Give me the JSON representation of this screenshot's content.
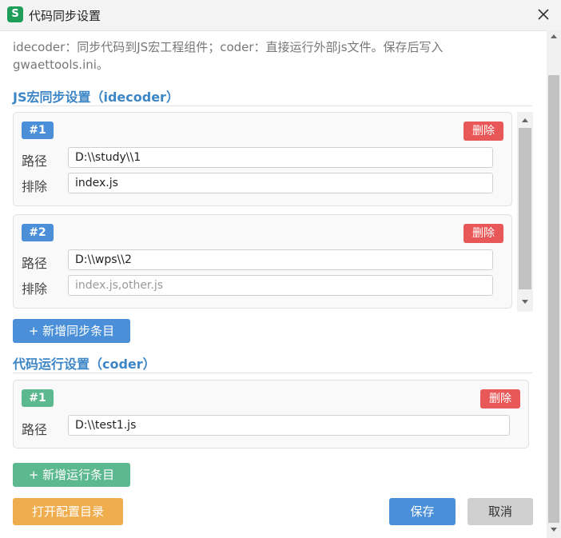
{
  "window": {
    "icon_letter": "S",
    "title": "代码同步设置",
    "close_glyph": "✕"
  },
  "description": "idecoder：同步代码到JS宏工程组件；coder：直接运行外部js文件。保存后写入gwaettools.ini。",
  "sync_section": {
    "title": "JS宏同步设置（idecoder）",
    "entries": [
      {
        "badge": "#1",
        "delete_label": "删除",
        "path_label": "路径",
        "path_value": "D:\\\\study\\\\1",
        "exclude_label": "排除",
        "exclude_value": "index.js",
        "exclude_placeholder": ""
      },
      {
        "badge": "#2",
        "delete_label": "删除",
        "path_label": "路径",
        "path_value": "D:\\\\wps\\\\2",
        "exclude_label": "排除",
        "exclude_value": "",
        "exclude_placeholder": "index.js,other.js"
      }
    ],
    "add_label": "+ 新增同步条目"
  },
  "run_section": {
    "title": "代码运行设置（coder）",
    "entries": [
      {
        "badge": "#1",
        "delete_label": "删除",
        "path_label": "路径",
        "path_value": "D:\\\\test1.js"
      }
    ],
    "add_label": "+ 新增运行条目"
  },
  "footer": {
    "open_dir_label": "打开配置目录",
    "save_label": "保存",
    "cancel_label": "取消"
  },
  "colors": {
    "accent_blue": "#4a8fd8",
    "accent_green": "#5cb88e",
    "danger_red": "#e85858",
    "warning_orange": "#f0ad4e",
    "section_title": "#3d86c6"
  }
}
